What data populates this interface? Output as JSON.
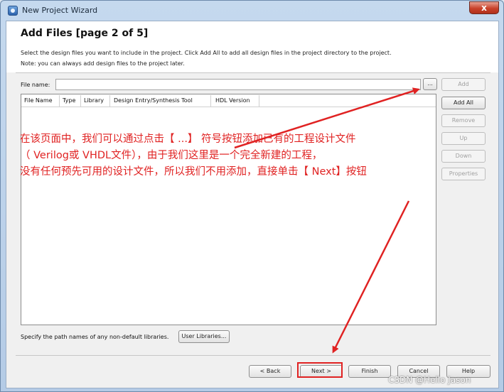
{
  "window": {
    "title": "New Project Wizard",
    "close_glyph": "x"
  },
  "header": {
    "title": "Add Files [page 2 of 5]",
    "line1": "Select the design files you want to include in the project. Click Add All to add all design files in the project directory to the project.",
    "line2": "Note: you can always add design files to the project later."
  },
  "file_name": {
    "label": "File name:",
    "value": "",
    "browse_label": "..."
  },
  "side_buttons": {
    "add": "Add",
    "add_all": "Add All",
    "remove": "Remove",
    "up": "Up",
    "down": "Down",
    "properties": "Properties"
  },
  "table": {
    "columns": [
      "File Name",
      "Type",
      "Library",
      "Design Entry/Synthesis Tool",
      "HDL Version"
    ],
    "rows": []
  },
  "libraries": {
    "label": "Specify the path names of any non-default libraries.",
    "button": "User Libraries..."
  },
  "footer": {
    "back": "< Back",
    "next": "Next >",
    "finish": "Finish",
    "cancel": "Cancel",
    "help": "Help"
  },
  "annotation": {
    "line1": "在该页面中，我们可以通过点击【 ...】 符号按钮添加已有的工程设计文件",
    "line2": "（ Verilog或 VHDL文件），由于我们这里是一个完全新建的工程，",
    "line3": "没有任何预先可用的设计文件，所以我们不用添加，直接单击【 Next】按钮",
    "color": "#e02222"
  },
  "watermark": "CSDN @Hello Jason"
}
